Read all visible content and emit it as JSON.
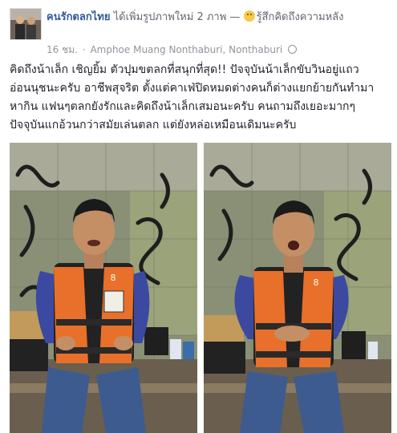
{
  "post": {
    "page_name": "คนรักตลกไทย",
    "action_text": "ได้เพิ่มรูปภาพใหม่ 2 ภาพ —",
    "feeling_text": "รู้สึกคิดถึงความหลัง",
    "time": "16 ชม.",
    "location": "Amphoe Muang Nonthaburi, Nonthaburi",
    "text": "คิดถึงน้าเล็ก เชิญยิ้ม ตัวปุมขตลกที่สนุกที่สุด!! ปัจจุบันน้าเล็กขับวินอยู่แถวอ่อนนุชนะครับ อาชีพสุจริต ตั้งแต่คาเฟ่ปิดหมดต่างคนก็ต่างแยกย้ายกันทำมาหากิน แฟนๆตลกยังรักและคิดถึงน้าเล็กเสมอนะครับ คนถามถึงเยอะมากๆ ปัจจุบันแกอ้วนกว่าสมัยเล่นตลก แต่ยังหล่อเหมือนเดิมนะครับ",
    "vest_number": "8"
  },
  "colors": {
    "link": "#365899",
    "meta": "#90949c",
    "vest_orange": "#e8702a",
    "shirt_blue": "#3b4aa0"
  },
  "icons": {
    "avatar": "page-avatar",
    "feeling": "smiley-emoji-icon",
    "privacy": "globe-icon"
  }
}
